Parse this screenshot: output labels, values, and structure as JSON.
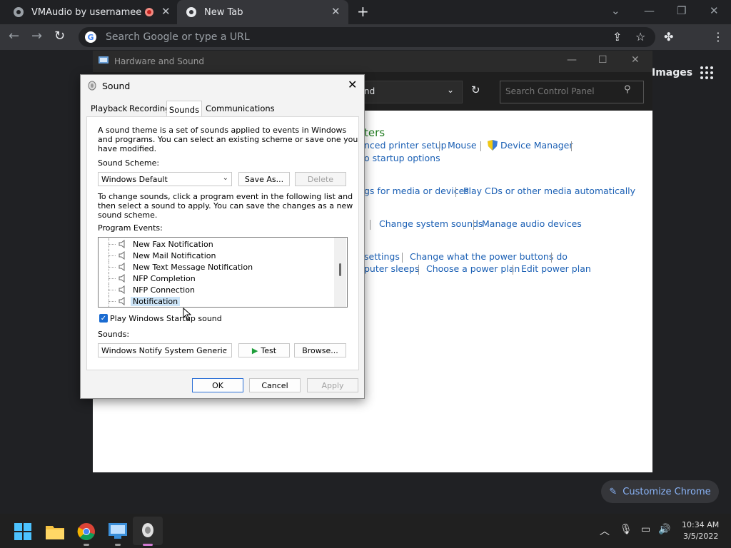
{
  "browser": {
    "tabs": [
      {
        "title": "VMAudio by usernamee"
      },
      {
        "title": "New Tab"
      }
    ],
    "new_tab_label": "+",
    "omnibox_placeholder": "Search Google or type a URL",
    "images_link": "Images",
    "customize_label": "Customize Chrome"
  },
  "control_panel": {
    "window_title": "Hardware and Sound",
    "address_fragment": "nd",
    "search_placeholder": "Search Control Panel",
    "heading_fragment": "ters",
    "rows": [
      [
        "nced printer setup",
        "Mouse",
        "Device Manager"
      ],
      [
        "o startup options"
      ],
      [
        "gs for media or devices",
        "Play CDs or other media automatically"
      ],
      [
        "Change system sounds",
        "Manage audio devices"
      ],
      [
        "settings",
        "Change what the power buttons do"
      ],
      [
        "puter sleeps",
        "Choose a power plan",
        "Edit power plan"
      ]
    ]
  },
  "sound_dialog": {
    "title": "Sound",
    "tabs": [
      "Playback",
      "Recording",
      "Sounds",
      "Communications"
    ],
    "active_tab": "Sounds",
    "intro_text": [
      "A sound theme is a set of sounds applied to events in Windows",
      "and programs.  You can select an existing scheme or save one you",
      "have modified."
    ],
    "scheme_label": "Sound Scheme:",
    "scheme_value": "Windows Default",
    "save_as_label": "Save As...",
    "delete_label": "Delete",
    "instructions_text": [
      "To change sounds, click a program event in the following list and",
      "then select a sound to apply.  You can save the changes as a new",
      "sound scheme."
    ],
    "events_label": "Program Events:",
    "events": [
      "New Fax Notification",
      "New Mail Notification",
      "New Text Message Notification",
      "NFP Completion",
      "NFP Connection",
      "Notification"
    ],
    "selected_event": "Notification",
    "startup_sound_label": "Play Windows Startup sound",
    "startup_sound_checked": true,
    "sounds_label": "Sounds:",
    "sounds_value": "Windows Notify System Generic",
    "test_label": "Test",
    "browse_label": "Browse...",
    "ok_label": "OK",
    "cancel_label": "Cancel",
    "apply_label": "Apply"
  },
  "taskbar": {
    "time": "10:34 AM",
    "date": "3/5/2022"
  },
  "colors": {
    "chrome_dark": "#202124",
    "chrome_toolbar": "#35363a",
    "link_blue": "#1a5fb4",
    "accent_blue": "#1a6bd1"
  }
}
